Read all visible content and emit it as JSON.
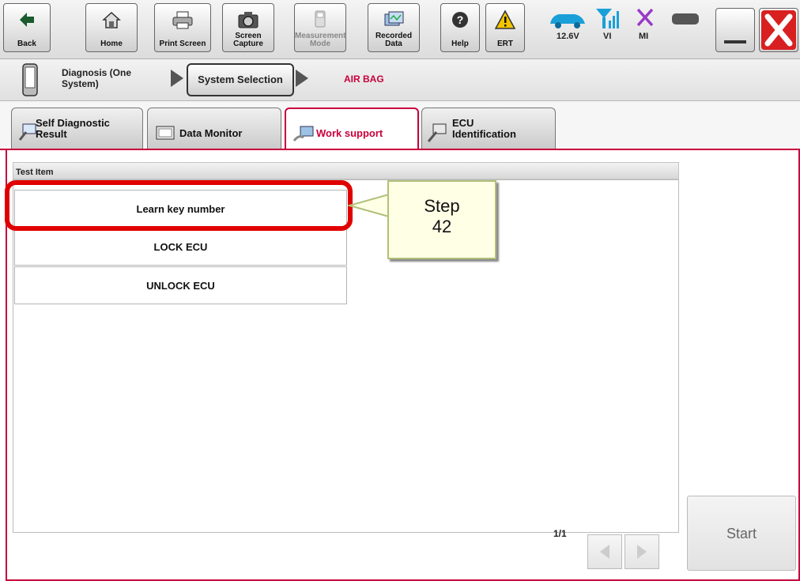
{
  "toolbar": {
    "back": "Back",
    "home": "Home",
    "print_screen": "Print Screen",
    "screen_capture": "Screen Capture",
    "measurement_mode": "Measurement Mode",
    "recorded_data": "Recorded Data",
    "help": "Help",
    "ert": "ERT",
    "battery_voltage": "12.6V",
    "vi": "VI",
    "mi": "MI"
  },
  "breadcrumb": {
    "diagnosis": "Diagnosis (One System)",
    "system_selection": "System Selection",
    "current": "AIR BAG"
  },
  "tabs": [
    {
      "label": "Self Diagnostic Result"
    },
    {
      "label": "Data Monitor"
    },
    {
      "label": "Work support"
    },
    {
      "label": "ECU Identification"
    }
  ],
  "list": {
    "header": "Test Item",
    "items": [
      "Learn key number",
      "LOCK ECU",
      "UNLOCK ECU"
    ]
  },
  "callout": "Step\n42",
  "pager": "1/1",
  "start_label": "Start",
  "colors": {
    "accent": "#c8003c",
    "highlight": "#e00000"
  }
}
